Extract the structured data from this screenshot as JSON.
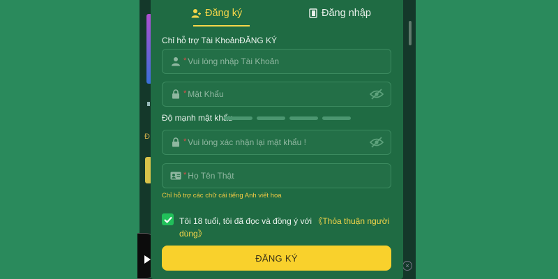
{
  "tabs": {
    "register_label": "Đăng ký",
    "login_label": "Đăng nhập"
  },
  "form": {
    "account_note": "Chỉ hỗ trợ Tài KhoảnĐĂNG KÝ",
    "username_placeholder": "Vui lòng nhập Tài Khoản",
    "password_placeholder": "Mật Khẩu",
    "strength_label": "Độ mạnh mật khẩu",
    "strength_segments": 4,
    "confirm_placeholder": "Vui lòng xác nhận lại mật khẩu !",
    "realname_placeholder": "Họ Tên Thật",
    "required_mark": "*",
    "realname_hint": "Chỉ hỗ trợ các chữ cái tiếng Anh viết hoa",
    "agree_text": "Tôi 18 tuổi, tôi đã đọc và đồng ý với ",
    "agree_link": "《Thỏa thuận người dùng》",
    "agree_checked": true,
    "submit_label": "ĐĂNG KÝ"
  },
  "colors": {
    "background": "#2a8a5c",
    "modal": "#1f6b43",
    "accent_yellow": "#f5d64a",
    "checkbox_green": "#21c05a",
    "required_red": "#e04a4a"
  },
  "icons": [
    "user-plus-icon",
    "login-door-icon",
    "user-icon",
    "lock-icon",
    "eye-off-icon",
    "id-card-icon",
    "check-icon",
    "play-icon",
    "close-circle-icon"
  ]
}
